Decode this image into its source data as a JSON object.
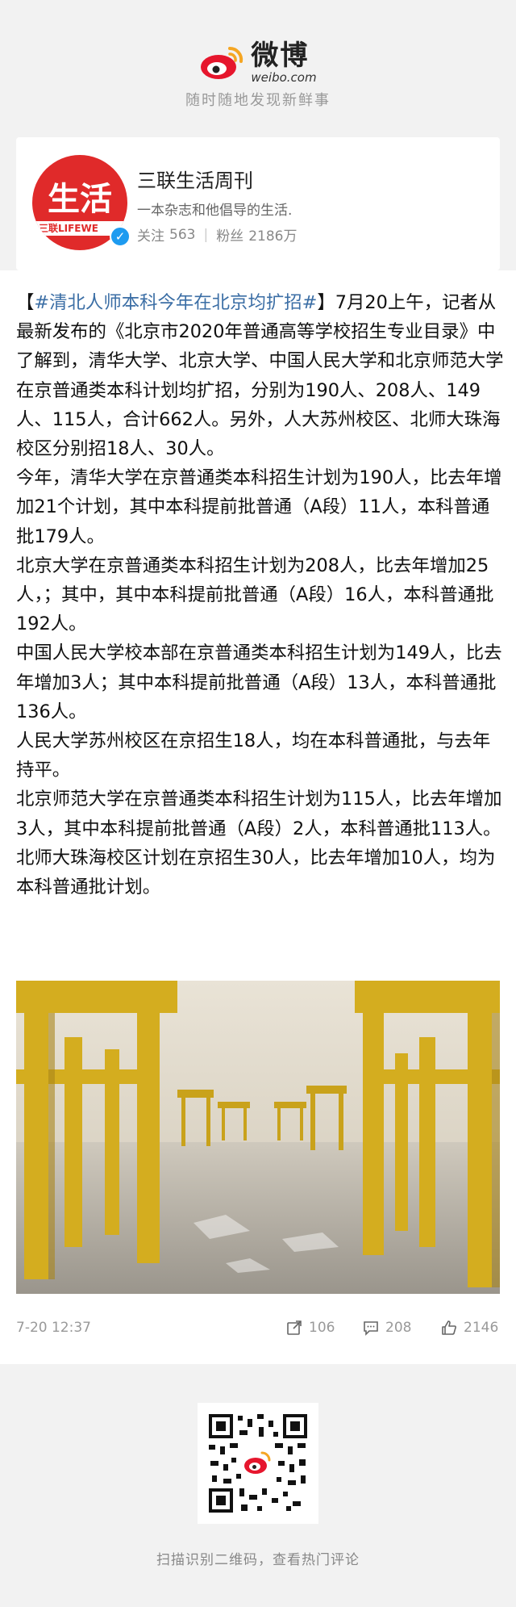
{
  "header": {
    "brand_cn": "微博",
    "brand_en": "weibo.com",
    "slogan": "随时随地发现新鲜事"
  },
  "profile": {
    "avatar_text": "生活",
    "avatar_band": "三联LIFEWE",
    "name": "三联生活周刊",
    "bio": "一本杂志和他倡导的生活.",
    "following_label": "关注",
    "following_count": "563",
    "followers_label": "粉丝",
    "followers_count": "2186万"
  },
  "post": {
    "open_bracket": "【",
    "hashtag": "#清北人师本科今年在北京均扩招#",
    "lead_rest": "】7月20上午，记者从最新发布的《北京市2020年普通高等学校招生专业目录》中了解到，清华大学、北京大学、中国人民大学和北京师范大学在京普通类本科计划均扩招，分别为190人、208人、149人、115人，合计662人。另外，人大苏州校区、北师大珠海校区分别招18人、30人。",
    "paragraphs": [
      "今年，清华大学在京普通类本科招生计划为190人，比去年增加21个计划，其中本科提前批普通（A段）11人，本科普通批179人。",
      "北京大学在京普通类本科招生计划为208人，比去年增加25人，；其中，其中本科提前批普通（A段）16人，本科普通批192人。",
      "中国人民大学校本部在京普通类本科招生计划为149人，比去年增加3人；其中本科提前批普通（A段）13人，本科普通批136人。",
      "人民大学苏州校区在京招生18人，均在本科普通批，与去年持平。",
      "北京师范大学在京普通类本科招生计划为115人，比去年增加3人，其中本科提前批普通（A段）2人，本科普通批113人。",
      "北师大珠海校区计划在京招生30人，比去年增加10人，均为本科普通批计划。"
    ],
    "date": "7-20 12:37",
    "reposts": "106",
    "comments": "208",
    "likes": "2146"
  },
  "footer": {
    "hint": "扫描识别二维码，查看热门评论"
  },
  "colors": {
    "brand_red": "#e02a2a",
    "link_blue": "#3b6ea5",
    "verified_blue": "#1d9bf0"
  }
}
